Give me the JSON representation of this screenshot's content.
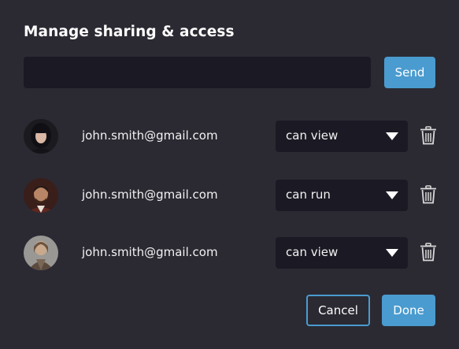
{
  "dialog": {
    "title": "Manage sharing & access",
    "share_input": {
      "value": "",
      "placeholder": ""
    },
    "send_label": "Send",
    "users": [
      {
        "email": "john.smith@gmail.com",
        "permission": "can view",
        "avatar": "avatar-woman-dark-hair"
      },
      {
        "email": "john.smith@gmail.com",
        "permission": "can run",
        "avatar": "avatar-man-beard"
      },
      {
        "email": "john.smith@gmail.com",
        "permission": "can view",
        "avatar": "avatar-person-light"
      }
    ],
    "cancel_label": "Cancel",
    "done_label": "Done"
  },
  "colors": {
    "background": "#2b2a33",
    "input_bg": "#1b1a24",
    "accent": "#4a9bcf",
    "text": "#ffffff"
  },
  "icons": {
    "dropdown": "caret-down-icon",
    "remove": "trash-icon"
  }
}
